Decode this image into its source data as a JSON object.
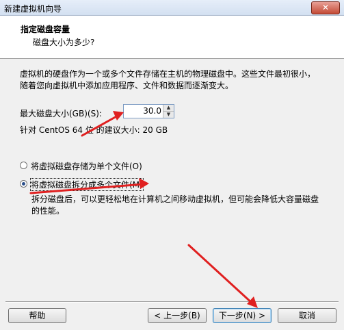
{
  "window": {
    "title": "新建虚拟机向导",
    "close_glyph": "✕"
  },
  "header": {
    "title": "指定磁盘容量",
    "subtitle": "磁盘大小为多少?"
  },
  "description": "虚拟机的硬盘作为一个或多个文件存储在主机的物理磁盘中。这些文件最初很小，随着您向虚拟机中添加应用程序、文件和数据而逐渐变大。",
  "disk_size": {
    "label": "最大磁盘大小(GB)(S):",
    "value": "30.0",
    "recommend": "针对 CentOS 64 位 的建议大小: 20 GB"
  },
  "storage_options": [
    {
      "label": "将虚拟磁盘存储为单个文件(O)",
      "selected": false
    },
    {
      "label": "将虚拟磁盘拆分成多个文件(M)",
      "selected": true
    }
  ],
  "split_note": "拆分磁盘后，可以更轻松地在计算机之间移动虚拟机，但可能会降低大容量磁盘的性能。",
  "buttons": {
    "help": "帮助",
    "back": "< 上一步(B)",
    "next": "下一步(N) >",
    "cancel": "取消"
  },
  "colors": {
    "annotation_arrow": "#e02020",
    "header_bg": "#ffffff",
    "dialog_bg": "#f0f0f0"
  }
}
